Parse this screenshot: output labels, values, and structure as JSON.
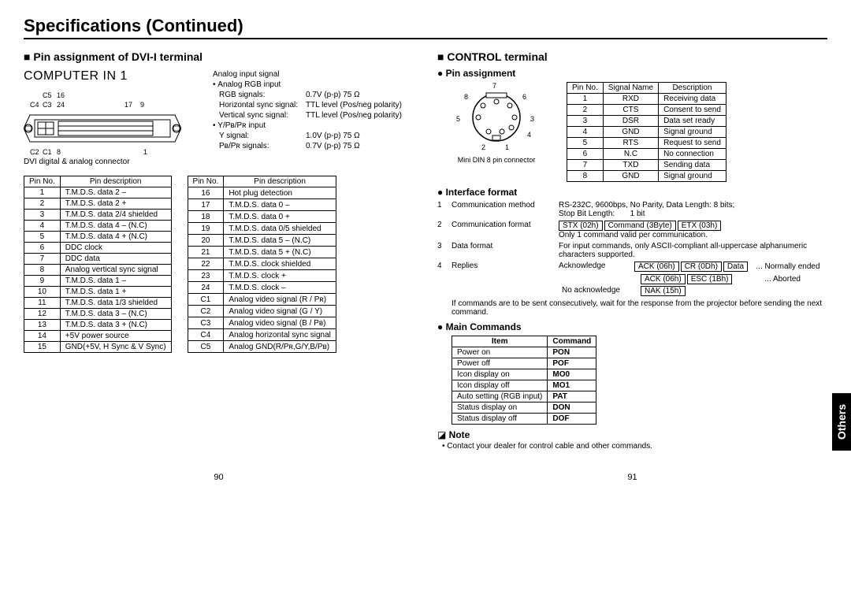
{
  "page_title": "Specifications (Continued)",
  "left": {
    "heading": "Pin assignment of DVI-I terminal",
    "computer_in": "COMPUTER IN 1",
    "pin_labels": {
      "c5": "C5",
      "n16": "16",
      "c4": "C4",
      "c3": "C3",
      "n24": "24",
      "n17": "17",
      "n9": "9",
      "c2": "C2",
      "c1": "C1",
      "n8": "8",
      "n1": "1"
    },
    "connector_caption": "DVI digital & analog connector",
    "analog": {
      "title": "Analog input signal",
      "sub": "Analog RGB input",
      "rows": [
        {
          "lbl": "RGB signals:",
          "val": "0.7V (p-p) 75 Ω"
        },
        {
          "lbl": "Horizontal sync signal:",
          "val": "TTL level (Pos/neg polarity)"
        },
        {
          "lbl": "Vertical sync signal:",
          "val": "TTL level (Pos/neg polarity)"
        }
      ],
      "sub2": "Y/Pʙ/Pʀ input",
      "rows2": [
        {
          "lbl": "Y signal:",
          "val": "1.0V (p-p) 75 Ω"
        },
        {
          "lbl": "Pʙ/Pʀ signals:",
          "val": "0.7V (p-p) 75 Ω"
        }
      ]
    },
    "table_headers": {
      "no": "Pin No.",
      "desc": "Pin description"
    },
    "pins_a": [
      {
        "n": "1",
        "d": "T.M.D.S. data 2 –"
      },
      {
        "n": "2",
        "d": "T.M.D.S. data 2 +"
      },
      {
        "n": "3",
        "d": "T.M.D.S. data 2/4 shielded"
      },
      {
        "n": "4",
        "d": "T.M.D.S. data 4 – (N.C)"
      },
      {
        "n": "5",
        "d": "T.M.D.S. data 4 + (N.C)"
      },
      {
        "n": "6",
        "d": "DDC clock"
      },
      {
        "n": "7",
        "d": "DDC data"
      },
      {
        "n": "8",
        "d": "Analog vertical sync signal"
      },
      {
        "n": "9",
        "d": "T.M.D.S. data 1 –"
      },
      {
        "n": "10",
        "d": "T.M.D.S. data 1 +"
      },
      {
        "n": "11",
        "d": "T.M.D.S. data 1/3 shielded"
      },
      {
        "n": "12",
        "d": "T.M.D.S. data 3 – (N.C)"
      },
      {
        "n": "13",
        "d": "T.M.D.S. data 3 + (N.C)"
      },
      {
        "n": "14",
        "d": "+5V power source"
      },
      {
        "n": "15",
        "d": "GND(+5V, H Sync & V Sync)"
      }
    ],
    "pins_b": [
      {
        "n": "16",
        "d": "Hot plug detection"
      },
      {
        "n": "17",
        "d": "T.M.D.S. data 0 –"
      },
      {
        "n": "18",
        "d": "T.M.D.S. data 0 +"
      },
      {
        "n": "19",
        "d": "T.M.D.S. data 0/5 shielded"
      },
      {
        "n": "20",
        "d": "T.M.D.S. data 5 – (N.C)"
      },
      {
        "n": "21",
        "d": "T.M.D.S. data 5 + (N.C)"
      },
      {
        "n": "22",
        "d": "T.M.D.S. clock shielded"
      },
      {
        "n": "23",
        "d": "T.M.D.S. clock +"
      },
      {
        "n": "24",
        "d": "T.M.D.S. clock –"
      },
      {
        "n": "C1",
        "d": "Analog video signal (R / Pʀ)"
      },
      {
        "n": "C2",
        "d": "Analog video signal (G / Y)"
      },
      {
        "n": "C3",
        "d": "Analog video signal (B / Pʙ)"
      },
      {
        "n": "C4",
        "d": "Analog horizontal sync signal"
      },
      {
        "n": "C5",
        "d": "Analog GND(R/Pʀ,G/Y,B/Pʙ)"
      }
    ],
    "page_num": "90"
  },
  "right": {
    "heading": "CONTROL terminal",
    "pin_assignment_title": "Pin assignment",
    "din_labels": {
      "n1": "1",
      "n2": "2",
      "n3": "3",
      "n4": "4",
      "n5": "5",
      "n6": "6",
      "n7": "7",
      "n8": "8"
    },
    "din_caption": "Mini DIN 8 pin connector",
    "control_headers": {
      "no": "Pin No.",
      "name": "Signal Name",
      "desc": "Description"
    },
    "control_pins": [
      {
        "n": "1",
        "s": "RXD",
        "d": "Receiving data"
      },
      {
        "n": "2",
        "s": "CTS",
        "d": "Consent to send"
      },
      {
        "n": "3",
        "s": "DSR",
        "d": "Data set ready"
      },
      {
        "n": "4",
        "s": "GND",
        "d": "Signal ground"
      },
      {
        "n": "5",
        "s": "RTS",
        "d": "Request to send"
      },
      {
        "n": "6",
        "s": "N.C",
        "d": "No connection"
      },
      {
        "n": "7",
        "s": "TXD",
        "d": "Sending data"
      },
      {
        "n": "8",
        "s": "GND",
        "d": "Signal ground"
      }
    ],
    "interface_title": "Interface format",
    "interface": [
      {
        "num": "1",
        "key": "Communication method",
        "val": "RS-232C, 9600bps, No Parity, Data Length: 8 bits;",
        "val2_lbl": "Stop Bit Length:",
        "val2_val": "1 bit"
      },
      {
        "num": "2",
        "key": "Communication format",
        "boxed": [
          "STX (02h)",
          "Command (3Byte)",
          "ETX (03h)"
        ],
        "note": "Only 1 command valid per communication."
      },
      {
        "num": "3",
        "key": "Data format",
        "val": "For input commands, only ASCII-compliant all-uppercase alphanumeric characters supported."
      }
    ],
    "replies": {
      "num": "4",
      "key": "Replies",
      "ack_lbl": "Acknowledge",
      "ack": [
        "ACK (06h)",
        "CR (0Dh)",
        "Data"
      ],
      "ack_end": "... Normally ended",
      "ack2": [
        "ACK (06h)",
        "ESC (1Bh)"
      ],
      "ack2_end": "... Aborted",
      "noack_lbl": "No acknowledge",
      "noack": [
        "NAK (15h)"
      ]
    },
    "consecutive_note": "If commands are to be sent consecutively, wait for the response from the projector before sending the next command.",
    "main_commands_title": "Main Commands",
    "cmd_headers": {
      "item": "Item",
      "cmd": "Command"
    },
    "commands": [
      {
        "i": "Power on",
        "c": "PON"
      },
      {
        "i": "Power off",
        "c": "POF"
      },
      {
        "i": "Icon display on",
        "c": "MO0"
      },
      {
        "i": "Icon display off",
        "c": "MO1"
      },
      {
        "i": "Auto setting (RGB input)",
        "c": "PAT"
      },
      {
        "i": "Status display on",
        "c": "DON"
      },
      {
        "i": "Status display off",
        "c": "DOF"
      }
    ],
    "note_title": "Note",
    "note_text": "Contact your dealer for control cable and other commands.",
    "page_num": "91",
    "tab": "Others"
  }
}
